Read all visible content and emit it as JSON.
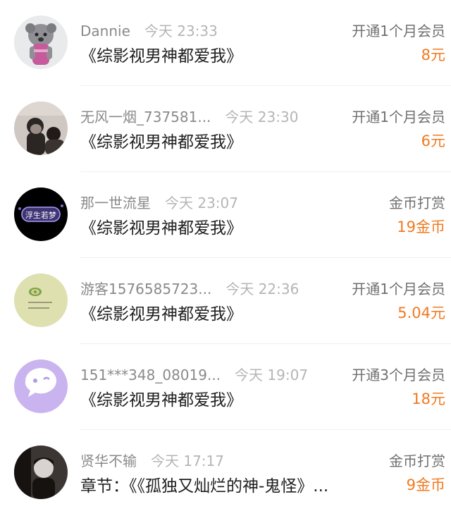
{
  "rows": [
    {
      "name": "Dannie",
      "time": "今天 23:33",
      "title": "《综影视男神都爱我》",
      "type": "开通1个月会员",
      "amount": "8元",
      "avatar_kind": "plush-toy",
      "avatar_colors": [
        "#e9eaec",
        "#8f8f95",
        "#c65a9b"
      ]
    },
    {
      "name": "无风一烟_737581...",
      "time": "今天 23:30",
      "title": "《综影视男神都爱我》",
      "type": "开通1个月会员",
      "amount": "6元",
      "avatar_kind": "photo-people",
      "avatar_colors": [
        "#cfc7c2",
        "#2b2624",
        "#8c7e78"
      ]
    },
    {
      "name": "那一世流星",
      "time": "今天 23:07",
      "title": "《综影视男神都爱我》",
      "type": "金币打赏",
      "amount": "19金币",
      "avatar_kind": "badge-text",
      "avatar_text": "浮生若梦",
      "avatar_colors": [
        "#000000",
        "#7b6cc9",
        "#ffffff"
      ]
    },
    {
      "name": "游客1576585723...",
      "time": "今天 22:36",
      "title": "《综影视男神都爱我》",
      "type": "开通1个月会员",
      "amount": "5.04元",
      "avatar_kind": "avocado",
      "avatar_colors": [
        "#dfe0b0",
        "#77a24a",
        "#b8803f"
      ]
    },
    {
      "name": "151***348_08019...",
      "time": "今天 19:07",
      "title": "《综影视男神都爱我》",
      "type": "开通3个月会员",
      "amount": "18元",
      "avatar_kind": "chat-bubble",
      "avatar_colors": [
        "#c9b4ef",
        "#ffffff",
        "#b39ae6"
      ]
    },
    {
      "name": "贤华不输",
      "time": "今天 17:17",
      "title": "章节：《《孤独又灿烂的神-鬼怪》...",
      "type": "金币打赏",
      "amount": "9金币",
      "avatar_kind": "photo-dark",
      "avatar_colors": [
        "#3b3533",
        "#d9d3cf",
        "#16120f"
      ]
    }
  ]
}
